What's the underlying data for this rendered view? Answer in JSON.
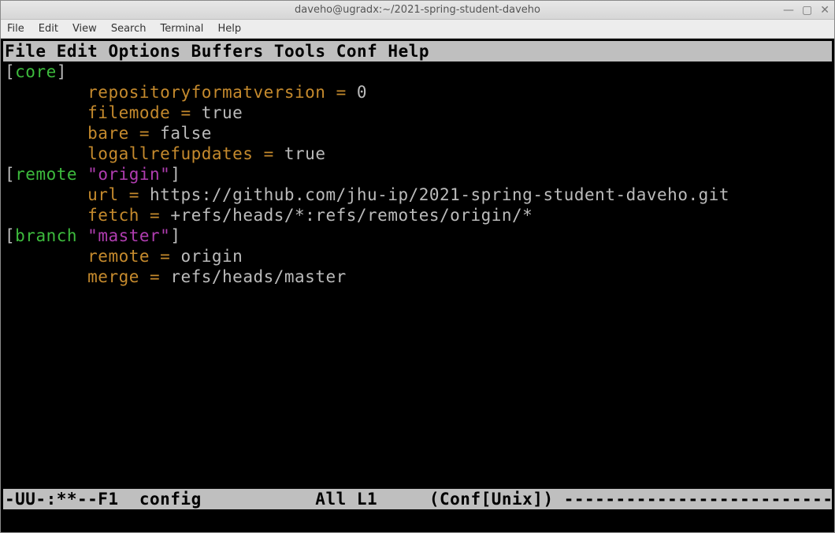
{
  "window": {
    "title": "daveho@ugradx:~/2021-spring-student-daveho",
    "controls": {
      "min": "—",
      "max": "▢",
      "close": "✕"
    }
  },
  "os_menu": {
    "items": [
      "File",
      "Edit",
      "View",
      "Search",
      "Terminal",
      "Help"
    ]
  },
  "emacs_menu": {
    "items": [
      "File",
      "Edit",
      "Options",
      "Buffers",
      "Tools",
      "Conf",
      "Help"
    ]
  },
  "content": {
    "sections": [
      {
        "name": "core",
        "quoted": null,
        "props": [
          {
            "key": "repositoryformatversion",
            "value": "0"
          },
          {
            "key": "filemode",
            "value": "true"
          },
          {
            "key": "bare",
            "value": "false"
          },
          {
            "key": "logallrefupdates",
            "value": "true"
          }
        ]
      },
      {
        "name": "remote",
        "quoted": "origin",
        "props": [
          {
            "key": "url",
            "value": "https://github.com/jhu-ip/2021-spring-student-daveho.git"
          },
          {
            "key": "fetch",
            "value": "+refs/heads/*:refs/remotes/origin/*"
          }
        ]
      },
      {
        "name": "branch",
        "quoted": "master",
        "props": [
          {
            "key": "remote",
            "value": "origin"
          },
          {
            "key": "merge",
            "value": "refs/heads/master"
          }
        ]
      }
    ],
    "indent": "        "
  },
  "modeline": {
    "left": "-UU-:**--F1  config  ",
    "mid": "    All L1     (Conf[Unix]) ",
    "dashes": "-----------------------------"
  }
}
